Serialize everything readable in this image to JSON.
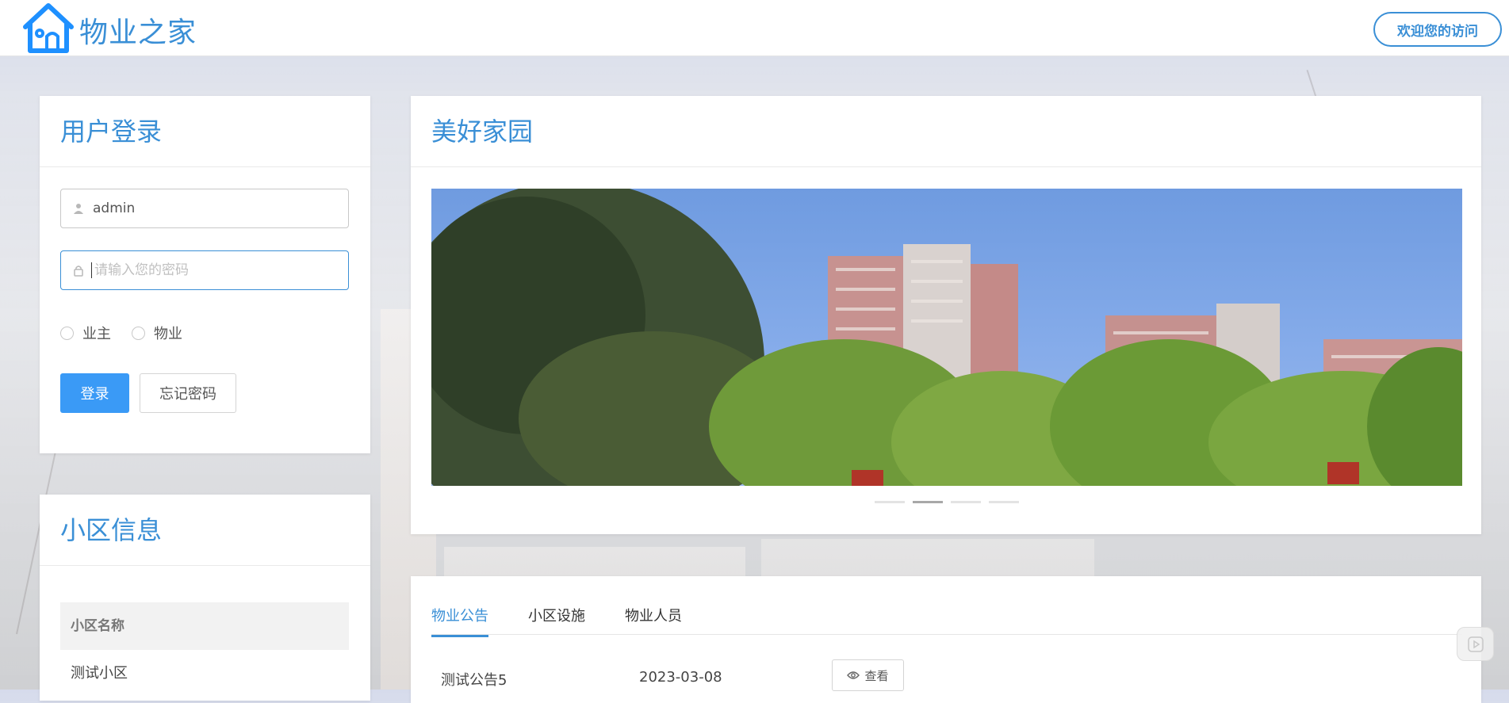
{
  "app": {
    "logo_text": "物业之家",
    "welcome": "欢迎您的访问"
  },
  "login": {
    "title": "用户登录",
    "username_value": "admin",
    "password_placeholder": "请输入您的密码",
    "roles": [
      "业主",
      "物业"
    ],
    "login_button": "登录",
    "forgot_button": "忘记密码"
  },
  "community": {
    "title": "小区信息",
    "header": "小区名称",
    "rows": [
      "测试小区"
    ]
  },
  "home": {
    "title": "美好家园",
    "carousel_count": 4,
    "carousel_active": 2
  },
  "notice": {
    "tabs": [
      "物业公告",
      "小区设施",
      "物业人员"
    ],
    "active_tab": 0,
    "items": [
      {
        "title": "测试公告5",
        "date": "2023-03-08",
        "action": "查看"
      }
    ]
  },
  "colors": {
    "accent": "#3a8fd6",
    "primary_button": "#3a9af6"
  },
  "icons": [
    "house-logo-icon",
    "user-icon",
    "lock-icon",
    "eye-icon",
    "play-icon"
  ]
}
